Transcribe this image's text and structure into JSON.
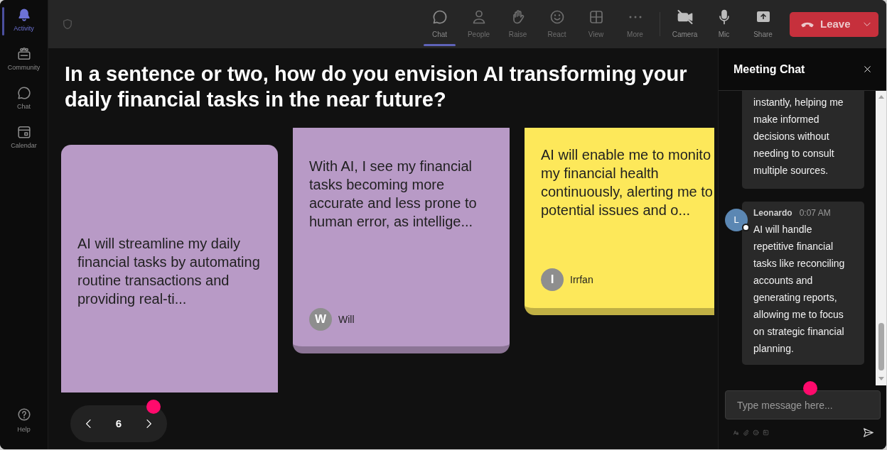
{
  "sidebar": {
    "items": [
      {
        "label": "Activity",
        "selected": true
      },
      {
        "label": "Community",
        "selected": false
      },
      {
        "label": "Chat",
        "selected": false
      },
      {
        "label": "Calendar",
        "selected": false
      }
    ],
    "help": {
      "label": "Help"
    }
  },
  "top_bar": {
    "panel_tabs": [
      {
        "label": "Chat",
        "selected": true
      },
      {
        "label": "People",
        "selected": false
      },
      {
        "label": "Raise",
        "selected": false
      },
      {
        "label": "React",
        "selected": false
      },
      {
        "label": "View",
        "selected": false
      },
      {
        "label": "More",
        "selected": false
      }
    ],
    "device_buttons": [
      {
        "label": "Camera",
        "on": false
      },
      {
        "label": "Mic",
        "on": true
      },
      {
        "label": "Share"
      }
    ],
    "leave_button": {
      "label": "Leave"
    }
  },
  "stage": {
    "question": "In a sentence or two, how do you envision AI transforming your daily financial tasks in the near future?",
    "cards": [
      {
        "color": "#b89ac6",
        "lines": [
          "AI will streamline my daily",
          "financial tasks by automating",
          "routine transactions and",
          "providing real-ti..."
        ]
      },
      {
        "color": "#b89ac6",
        "lines": [
          "With AI, I see my financial",
          "tasks becoming more",
          "accurate and less prone to",
          "human error, as intellige..."
        ],
        "author": {
          "initial": "W",
          "name": "Will"
        }
      },
      {
        "color": "#fde85a",
        "lines": [
          "AI will enable me to monito",
          "my financial health",
          "continuously, alerting me to",
          "potential issues and o..."
        ],
        "author": {
          "initial": "I",
          "name": "Irrfan"
        }
      }
    ],
    "pager": {
      "page": "6"
    }
  },
  "chat": {
    "title": "Meeting Chat",
    "messages": [
      {
        "lines": [
          "instantly, helping me",
          "make informed",
          "decisions without",
          "needing to consult",
          "multiple sources."
        ]
      },
      {
        "sender": "Leonardo",
        "time": "0:07 AM",
        "initial": "L",
        "lines": [
          "AI will handle",
          "repetitive financial",
          "tasks like reconciling",
          "accounts and",
          "generating reports,",
          "allowing me to focus",
          "on strategic financial",
          "planning."
        ]
      }
    ],
    "input": {
      "placeholder": "Type message here..."
    }
  }
}
